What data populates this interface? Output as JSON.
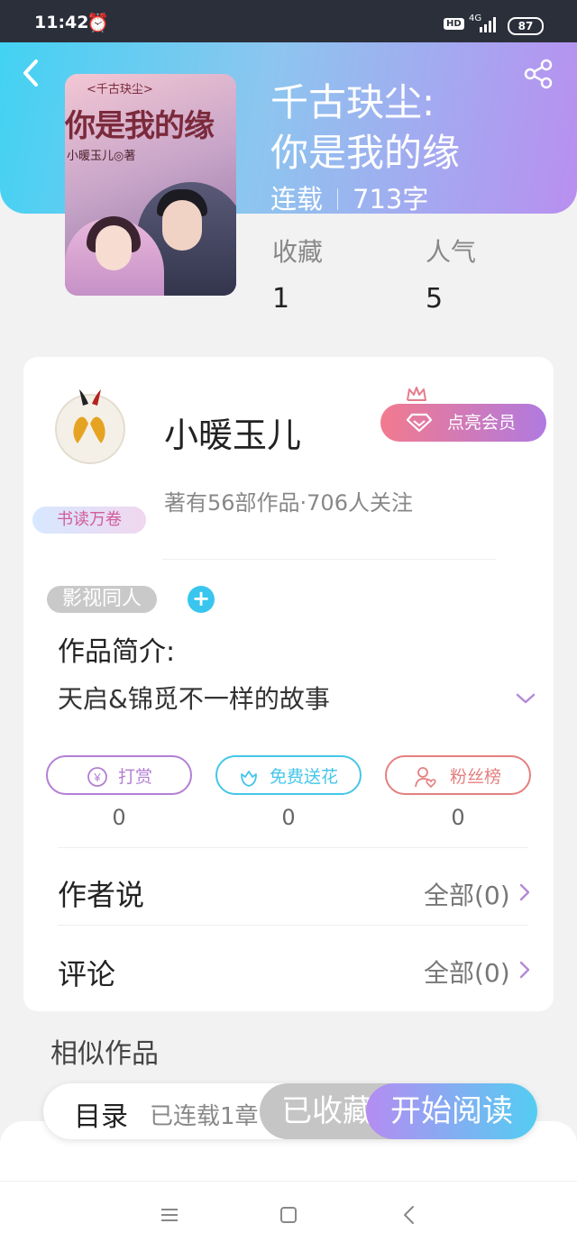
{
  "status_bar": {
    "time": "11:42",
    "hd": "HD",
    "network": "4G",
    "battery": "87"
  },
  "book": {
    "title_line1": "千古玦尘:",
    "title_line2": "你是我的缘",
    "status": "连载",
    "word_count": "713字",
    "cover": {
      "top_text": "<千古玦尘>",
      "title": "你是我的缘",
      "author": "小暖玉儿◎著"
    }
  },
  "stats": {
    "favorites_label": "收藏",
    "favorites_value": "1",
    "popularity_label": "人气",
    "popularity_value": "5"
  },
  "author": {
    "name": "小暖玉儿",
    "info": "著有56部作品·706人关注",
    "badge": "书读万卷",
    "vip_button": "点亮会员"
  },
  "tag": "影视同人",
  "intro": {
    "heading": "作品简介:",
    "text": "天启&锦觅不一样的故事"
  },
  "actions": [
    {
      "label": "打赏",
      "count": "0",
      "color": "#b37fd4"
    },
    {
      "label": "免费送花",
      "count": "0",
      "color": "#45c6e8"
    },
    {
      "label": "粉丝榜",
      "count": "0",
      "color": "#e57f7f"
    }
  ],
  "rows": [
    {
      "label": "作者说",
      "link": "全部(0)"
    },
    {
      "label": "评论",
      "link": "全部(0)"
    }
  ],
  "similar_heading": "相似作品",
  "bottom": {
    "toc": "目录",
    "toc_sub": "已连载1章",
    "collected": "已收藏",
    "start_reading": "开始阅读"
  },
  "icons": {
    "back": "chevron-left-icon",
    "share": "share-icon",
    "alarm": "alarm-icon",
    "vip": "diamond-icon",
    "reward": "yen-icon",
    "flower": "flower-icon",
    "fans": "person-heart-icon"
  }
}
